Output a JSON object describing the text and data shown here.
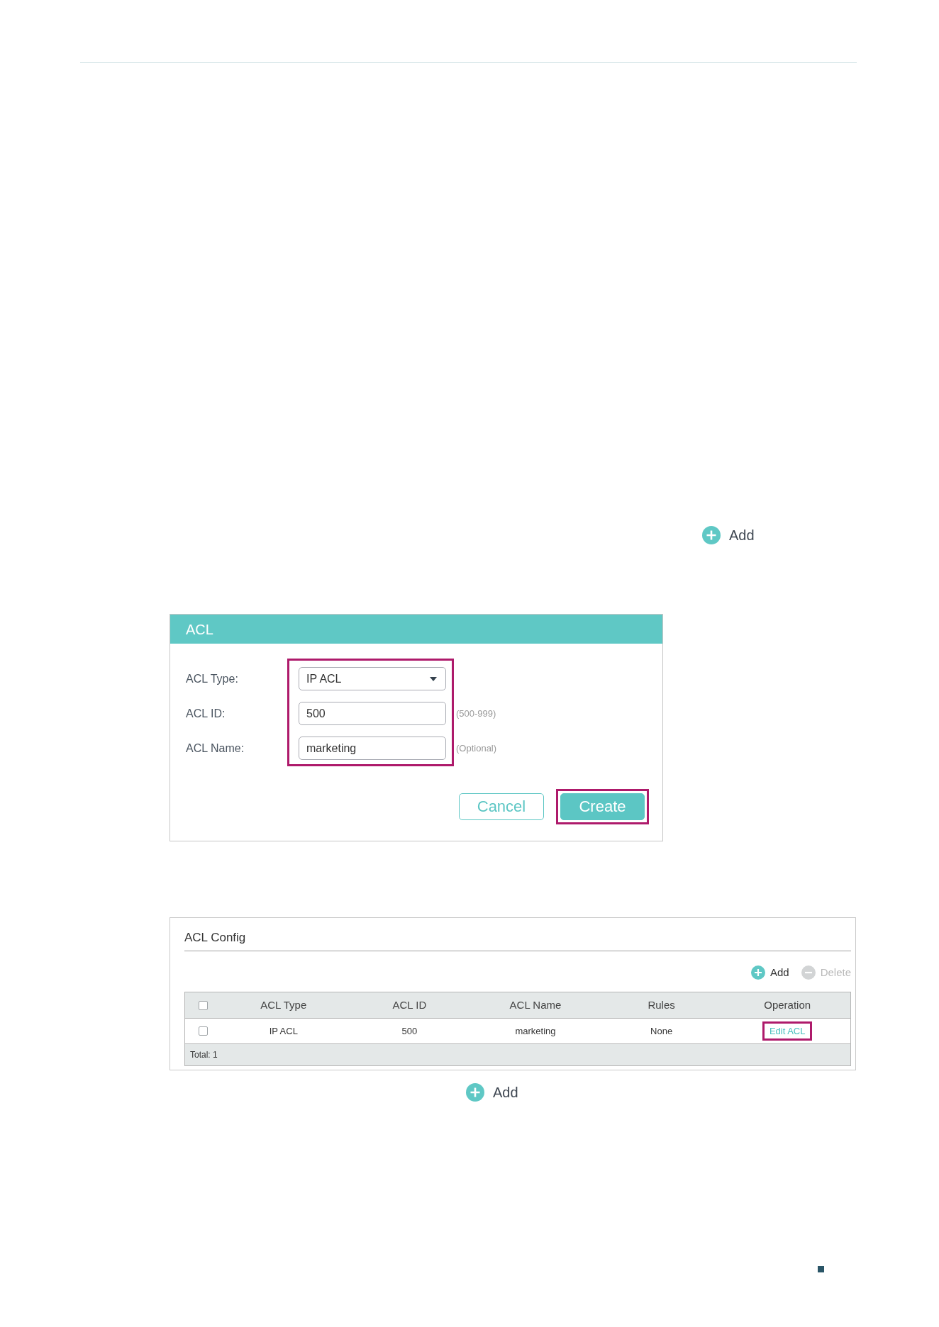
{
  "add_top": {
    "label": "Add"
  },
  "dialog": {
    "title": "ACL",
    "fields_highlighted": true,
    "fields": [
      {
        "kind": "select",
        "label": "ACL Type:",
        "value": "IP ACL"
      },
      {
        "kind": "text",
        "label": "ACL ID:",
        "value": "500",
        "hint": "(500-999)"
      },
      {
        "kind": "text",
        "label": "ACL Name:",
        "value": "marketing",
        "hint": "(Optional)"
      }
    ],
    "buttons": [
      {
        "kind": "secondary",
        "label": "Cancel",
        "highlighted": false
      },
      {
        "kind": "primary",
        "label": "Create",
        "highlighted": true
      }
    ]
  },
  "acl_config": {
    "title": "ACL Config",
    "toolbar": [
      {
        "kind": "add",
        "label": "Add",
        "disabled": false
      },
      {
        "kind": "delete",
        "label": "Delete",
        "disabled": true
      }
    ],
    "table": {
      "header_checked": false,
      "columns": [
        "ACL Type",
        "ACL ID",
        "ACL Name",
        "Rules",
        "Operation"
      ],
      "rows": [
        {
          "checked": false,
          "cells": [
            "IP ACL",
            "500",
            "marketing",
            "None"
          ],
          "operation": {
            "label": "Edit ACL",
            "highlighted": true
          }
        }
      ],
      "footer": "Total: 1"
    }
  },
  "add_bottom": {
    "label": "Add"
  }
}
